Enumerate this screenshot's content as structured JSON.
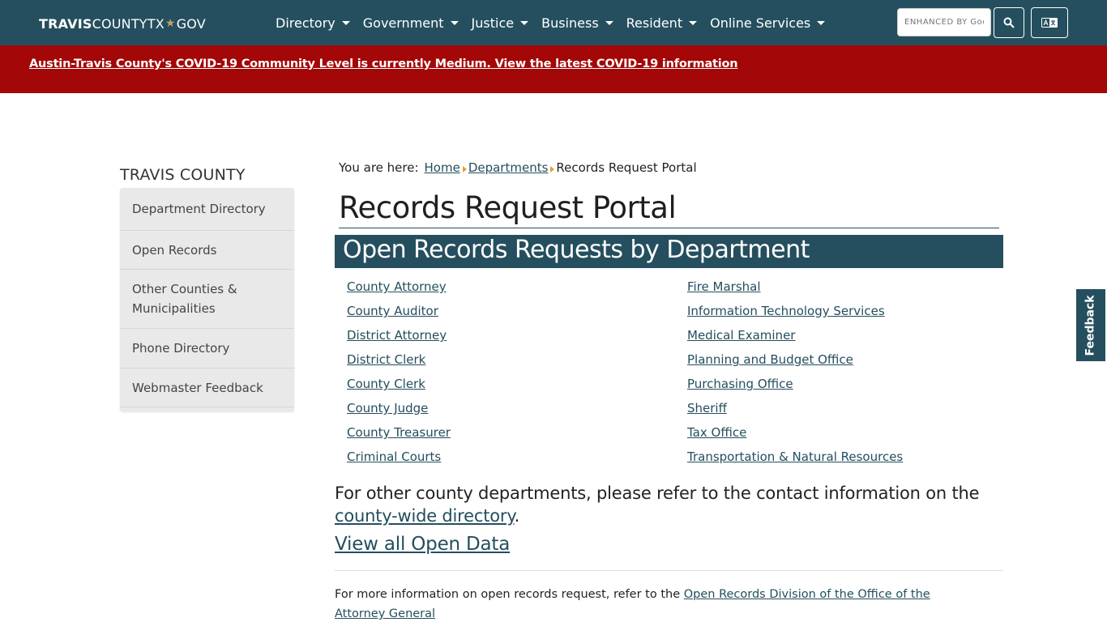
{
  "header": {
    "logo": {
      "bold": "TRAVIS",
      "middle": "COUNTYTX",
      "star": "★",
      "end": "GOV"
    },
    "menu": [
      {
        "label": "Directory"
      },
      {
        "label": "Government"
      },
      {
        "label": "Justice"
      },
      {
        "label": "Business"
      },
      {
        "label": "Resident"
      },
      {
        "label": "Online Services"
      }
    ],
    "search_placeholder": "ENHANCED BY Google"
  },
  "alert": {
    "text": "Austin-Travis County's COVID-19 Community Level is currently Medium. View the latest COVID-19 information"
  },
  "sidebar": {
    "title": "TRAVIS COUNTY",
    "items": [
      {
        "label": "Department Directory"
      },
      {
        "label": "Open Records"
      },
      {
        "label": "Other Counties & Municipalities"
      },
      {
        "label": "Phone Directory"
      },
      {
        "label": "Webmaster Feedback"
      }
    ]
  },
  "breadcrumb": {
    "prefix": "You are here:",
    "home": "Home",
    "departments": "Departments",
    "current": "Records Request Portal"
  },
  "page_title": "Records Request Portal",
  "section_title": "Open Records Requests by Department",
  "departments_left": [
    "County Attorney",
    "County Auditor",
    "District Attorney",
    "District Clerk",
    "County Clerk",
    "County Judge",
    "County Treasurer",
    "Criminal Courts"
  ],
  "departments_right": [
    "Fire Marshal",
    "Information Technology Services",
    "Medical Examiner",
    "Planning and Budget Office",
    "Purchasing Office",
    "Sheriff",
    "Tax Office",
    "Transportation & Natural Resources"
  ],
  "other_departments": {
    "text": "For other county departments, please refer to the contact information on the",
    "link": "county-wide directory",
    "end": "."
  },
  "open_data_link": "View all Open Data",
  "footer_note": {
    "text": "For more information on open records request, refer to the",
    "link": "Open Records Division of the Office of the Attorney General"
  },
  "feedback_tab": "Feedback"
}
